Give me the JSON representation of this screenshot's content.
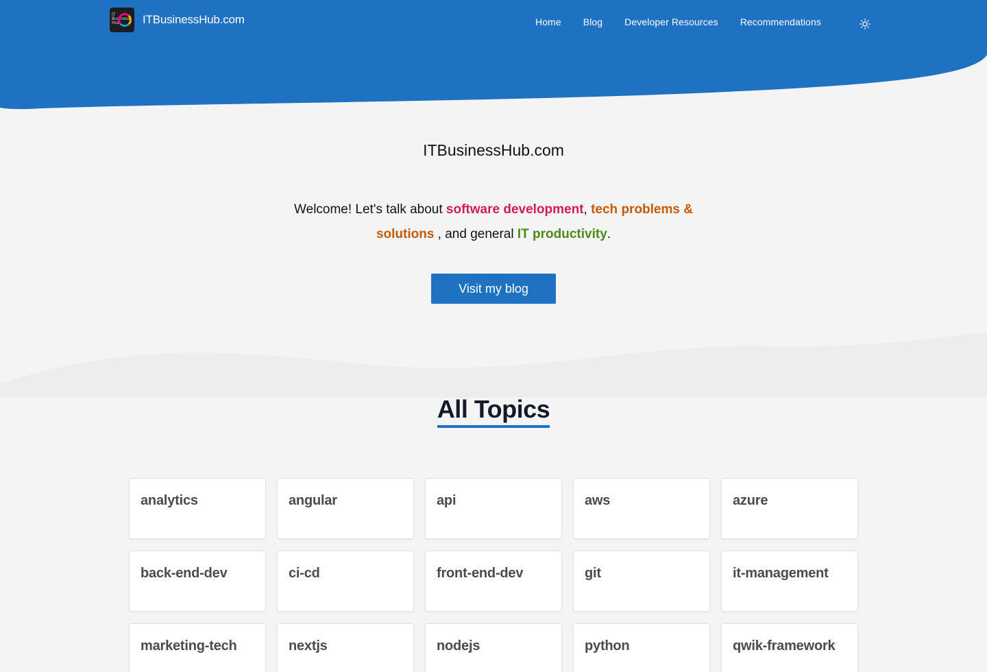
{
  "colors": {
    "primary": "#1f72c2",
    "background": "#f4f4f4",
    "pink": "#d31b5c",
    "orange": "#c45a00",
    "green": "#4c8a1a"
  },
  "header": {
    "brand": "ITBusinessHub.com",
    "logo_text": "IT Business Hub",
    "nav": [
      "Home",
      "Blog",
      "Developer Resources",
      "Recommendations"
    ],
    "theme_icon": "sun-icon"
  },
  "hero": {
    "title": "ITBusinessHub.com",
    "text_1": "Welcome! Let's talk about ",
    "hl_1": "software development",
    "text_2": ", ",
    "hl_2": "tech problems & solutions",
    "text_3": " , and general ",
    "hl_3": "IT productivity",
    "text_4": ".",
    "button": "Visit my blog"
  },
  "topics": {
    "title": "All Topics",
    "items": [
      "analytics",
      "angular",
      "api",
      "aws",
      "azure",
      "back-end-dev",
      "ci-cd",
      "front-end-dev",
      "git",
      "it-management",
      "marketing-tech",
      "nextjs",
      "nodejs",
      "python",
      "qwik-framework"
    ]
  }
}
